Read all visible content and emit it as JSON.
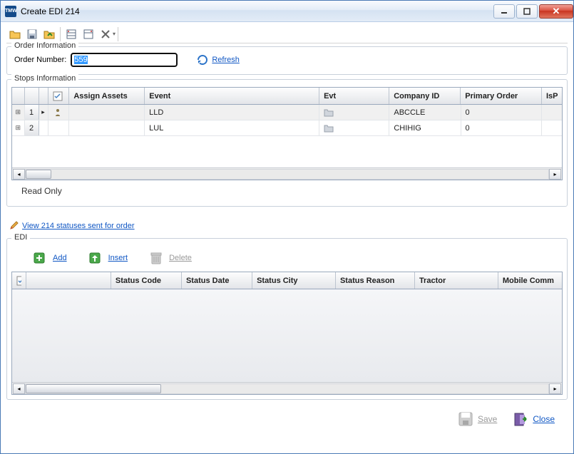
{
  "window": {
    "title": "Create EDI 214",
    "app_icon": "TMW"
  },
  "toolbar": {
    "open": "folder-open-icon",
    "save": "save-icon",
    "import": "import-icon",
    "view_list": "list-view-icon",
    "tool_a": "tool-icon",
    "delete": "x-icon"
  },
  "order_info": {
    "legend": "Order Information",
    "label": "Order Number:",
    "value": "559",
    "refresh": "Refresh"
  },
  "stops": {
    "legend": "Stops Information",
    "columns": [
      "Assign Assets",
      "Event",
      "Evt",
      "Company ID",
      "Primary Order",
      "IsP"
    ],
    "rows": [
      {
        "n": "1",
        "assets": "",
        "event": "LLD",
        "evt": "",
        "company": "ABCCLE",
        "primary": "0"
      },
      {
        "n": "2",
        "assets": "",
        "event": "LUL",
        "evt": "",
        "company": "CHIHIG",
        "primary": "0"
      }
    ],
    "readonly": "Read Only"
  },
  "statuses_link": "View 214 statuses sent for order",
  "edi": {
    "legend": "EDI",
    "add": "Add",
    "insert": "Insert",
    "delete": "Delete",
    "columns": [
      "",
      "Status Code",
      "Status Date",
      "Status City",
      "Status Reason",
      "Tractor",
      "Mobile Comm"
    ]
  },
  "footer": {
    "save": "Save",
    "close": "Close"
  }
}
